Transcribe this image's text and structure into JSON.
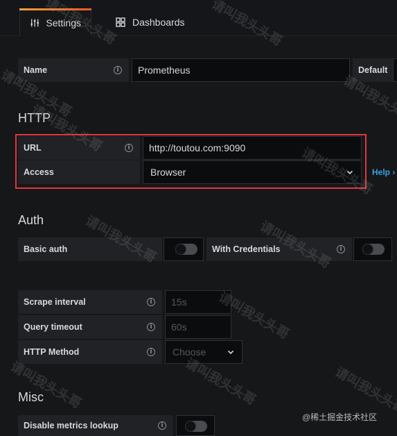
{
  "tabs": [
    {
      "label": "Settings",
      "icon": "sliders-icon",
      "active": true
    },
    {
      "label": "Dashboards",
      "icon": "dashboards-grid-icon",
      "active": false
    }
  ],
  "name_row": {
    "label": "Name",
    "value": "Prometheus",
    "default_label": "Default"
  },
  "http": {
    "title": "HTTP",
    "url_label": "URL",
    "url_value": "http://toutou.com:9090",
    "access_label": "Access",
    "access_value": "Browser",
    "help_label": "Help"
  },
  "auth": {
    "title": "Auth",
    "basic_auth_label": "Basic auth",
    "with_credentials_label": "With Credentials"
  },
  "prometheus": {
    "scrape_label": "Scrape interval",
    "scrape_placeholder": "15s",
    "timeout_label": "Query timeout",
    "timeout_placeholder": "60s",
    "method_label": "HTTP Method",
    "method_placeholder": "Choose"
  },
  "misc": {
    "title": "Misc",
    "disable_metrics_label": "Disable metrics lookup"
  },
  "watermark_text": "请叫我头头哥",
  "credit_text": "@稀土掘金技术社区",
  "colors": {
    "background": "#161719",
    "label_bg": "#212226",
    "input_bg": "#0b0c0e",
    "accent_gradient_start": "#f7a132",
    "accent_gradient_end": "#f05a28",
    "highlight_border": "#e2373d",
    "help_link": "#33a2e5"
  }
}
